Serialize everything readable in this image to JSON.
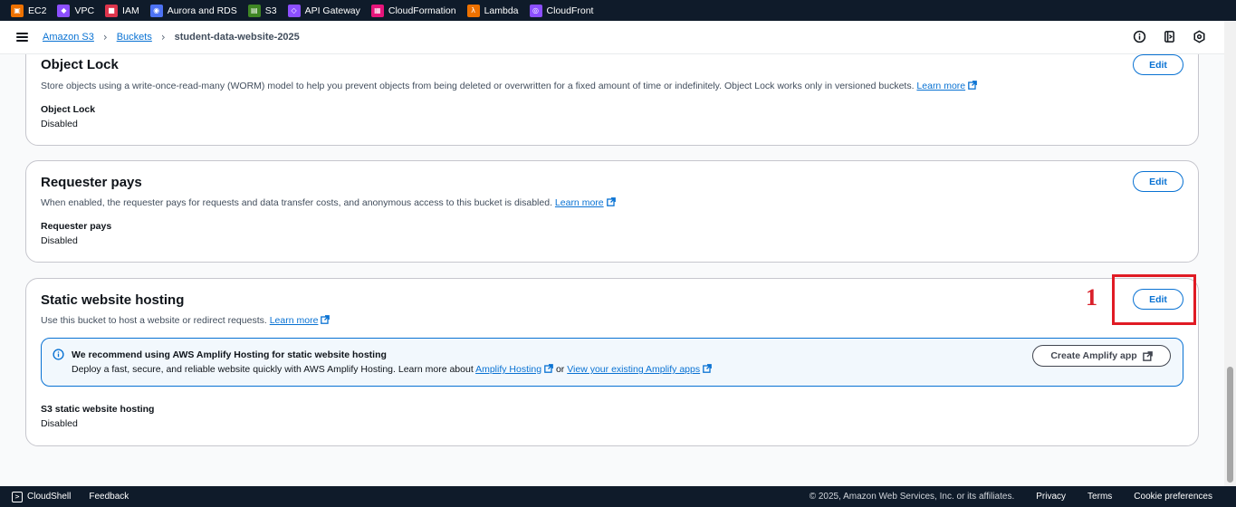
{
  "favorites": [
    {
      "label": "EC2",
      "color": "#ed7100",
      "glyph": "▣"
    },
    {
      "label": "VPC",
      "color": "#8c4fff",
      "glyph": "◆"
    },
    {
      "label": "IAM",
      "color": "#dd344c",
      "glyph": "■"
    },
    {
      "label": "Aurora and RDS",
      "color": "#4d72f3",
      "glyph": "◉"
    },
    {
      "label": "S3",
      "color": "#3f8624",
      "glyph": "▤"
    },
    {
      "label": "API Gateway",
      "color": "#8c4fff",
      "glyph": "◇"
    },
    {
      "label": "CloudFormation",
      "color": "#e7157b",
      "glyph": "▦"
    },
    {
      "label": "Lambda",
      "color": "#ed7100",
      "glyph": "λ"
    },
    {
      "label": "CloudFront",
      "color": "#8c4fff",
      "glyph": "◎"
    }
  ],
  "breadcrumb": {
    "items": [
      "Amazon S3",
      "Buckets"
    ],
    "current": "student-data-website-2025"
  },
  "cards": {
    "object_lock": {
      "title": "Object Lock",
      "description": "Store objects using a write-once-read-many (WORM) model to help you prevent objects from being deleted or overwritten for a fixed amount of time or indefinitely. Object Lock works only in versioned buckets.",
      "learn_more": "Learn more",
      "key_label": "Object Lock",
      "value": "Disabled",
      "edit_label": "Edit"
    },
    "requester_pays": {
      "title": "Requester pays",
      "description": "When enabled, the requester pays for requests and data transfer costs, and anonymous access to this bucket is disabled.",
      "learn_more": "Learn more",
      "key_label": "Requester pays",
      "value": "Disabled",
      "edit_label": "Edit"
    },
    "static_hosting": {
      "title": "Static website hosting",
      "description": "Use this bucket to host a website or redirect requests.",
      "learn_more": "Learn more",
      "key_label": "S3 static website hosting",
      "value": "Disabled",
      "edit_label": "Edit",
      "info": {
        "title": "We recommend using AWS Amplify Hosting for static website hosting",
        "text_before": "Deploy a fast, secure, and reliable website quickly with AWS Amplify Hosting. Learn more about",
        "link1": "Amplify Hosting",
        "text_mid": "or",
        "link2": "View your existing Amplify apps",
        "button": "Create Amplify app"
      }
    }
  },
  "annotation": {
    "number": "1"
  },
  "footer": {
    "cloudshell": "CloudShell",
    "feedback": "Feedback",
    "copyright": "© 2025, Amazon Web Services, Inc. or its affiliates.",
    "privacy": "Privacy",
    "terms": "Terms",
    "cookies": "Cookie preferences"
  },
  "colors": {
    "link": "#0972d3",
    "annotation": "#e01b24",
    "nav": "#0f1b2a"
  }
}
